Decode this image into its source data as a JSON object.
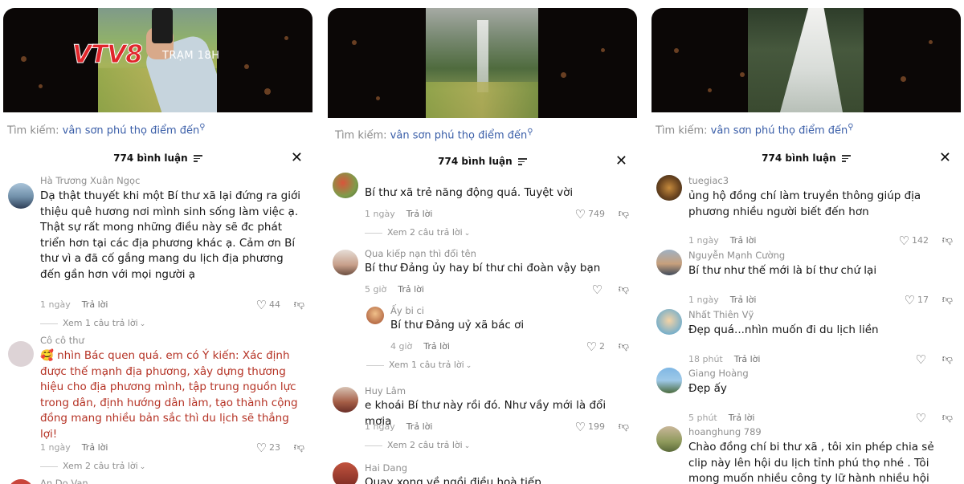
{
  "broadcaster": {
    "logo_part1": "VTV",
    "logo_part2": "8",
    "channel": "TRẠM 18H"
  },
  "panels": [
    {
      "search": {
        "label": "Tìm kiếm:",
        "query": "vân sơn phú thọ điểm đến"
      },
      "header": {
        "count_label": "774 bình luận"
      },
      "comments": [
        {
          "username": "Hà Trương Xuân Ngọc",
          "text": "Dạ thật thuyết khi một Bí thư xã lại đứng ra giới thiệu quê hương nơi mình sinh sống làm việc ạ. Thật sự rất mong những điều này sẽ đc phát triển hơn tại các địa phương khác ạ. Cảm ơn Bí thư vì a đã cố gắng mang du lịch địa phương đến gần hơn với mọi người ạ",
          "time": "1 ngày",
          "reply": "Trả lời",
          "likes": "44",
          "view_replies": "Xem 1 câu trả lời"
        },
        {
          "username": "Cô cô thư",
          "emoji": "🥰",
          "text": "nhìn Bác quen quá. em có Ý kiến: Xác định được thế mạnh địa phương, xây dựng thương hiệu cho địa phương mình, tập trung nguồn lực trong dân, định hướng dân làm, tạo thành cộng đồng mang nhiều bản sắc thì du lịch sẽ thắng lợi!",
          "time": "1 ngày",
          "reply": "Trả lời",
          "likes": "23",
          "view_replies": "Xem 2 câu trả lời"
        },
        {
          "username": "An Do Van"
        }
      ]
    },
    {
      "search": {
        "label": "Tìm kiếm:",
        "query": "vân sơn phú thọ điểm đến"
      },
      "header": {
        "count_label": "774 bình luận"
      },
      "comments": [
        {
          "username": "",
          "text": "Bí thư xã trẻ năng động quá. Tuyệt vời",
          "time": "1 ngày",
          "reply": "Trả lời",
          "likes": "749",
          "view_replies": "Xem 2 câu trả lời"
        },
        {
          "username": "Qua kiếp nạn thì đổi tên",
          "text": "Bí thư Đảng ủy hay bí thư chi đoàn vậy bạn",
          "time": "5 giờ",
          "reply": "Trả lời",
          "likes": ""
        },
        {
          "username": "Ấy bi ci",
          "text": "Bí thư Đảng uỷ xã bác ơi",
          "time": "4 giờ",
          "reply": "Trả lời",
          "likes": "2",
          "view_replies": "Xem 1 câu trả lời"
        },
        {
          "username": "Huy Lâm",
          "text": "e khoái Bí thư này rồi đó. Như vầy mới là đổi mơia",
          "time": "1 ngày",
          "reply": "Trả lời",
          "likes": "199",
          "view_replies": "Xem 2 câu trả lời"
        },
        {
          "username": "Hai Dang",
          "text": "Quay xong về ngồi điều hoà tiếp"
        }
      ]
    },
    {
      "search": {
        "label": "Tìm kiếm:",
        "query": "vân sơn phú thọ điểm đến"
      },
      "header": {
        "count_label": "774 bình luận"
      },
      "comments": [
        {
          "username": "tuegiac3",
          "text": "ủng hộ đồng chí làm truyền thông giúp địa phương nhiều người biết đến hơn",
          "time": "1 ngày",
          "reply": "Trả lời",
          "likes": "142"
        },
        {
          "username": "Nguyễn Mạnh Cường",
          "text": "Bí thư như thế mới là bí thư chứ lại",
          "time": "1 ngày",
          "reply": "Trả lời",
          "likes": "17"
        },
        {
          "username": "Nhất Thiên Vỹ",
          "text": "Đẹp quá...nhìn muốn đi du lịch liền",
          "time": "18 phút",
          "reply": "Trả lời",
          "likes": ""
        },
        {
          "username": "Giang Hoàng",
          "text": "Đẹp ấy",
          "time": "5 phút",
          "reply": "Trả lời",
          "likes": ""
        },
        {
          "username": "hoanghung 789",
          "text": "Chào đồng chí bi thư xã , tôi xin phép chia sẻ clip này lên hội du lịch tỉnh phú thọ nhé . Tôi mong muốn nhiều công ty lữ hành nhiều hội viên hội du"
        }
      ]
    }
  ]
}
